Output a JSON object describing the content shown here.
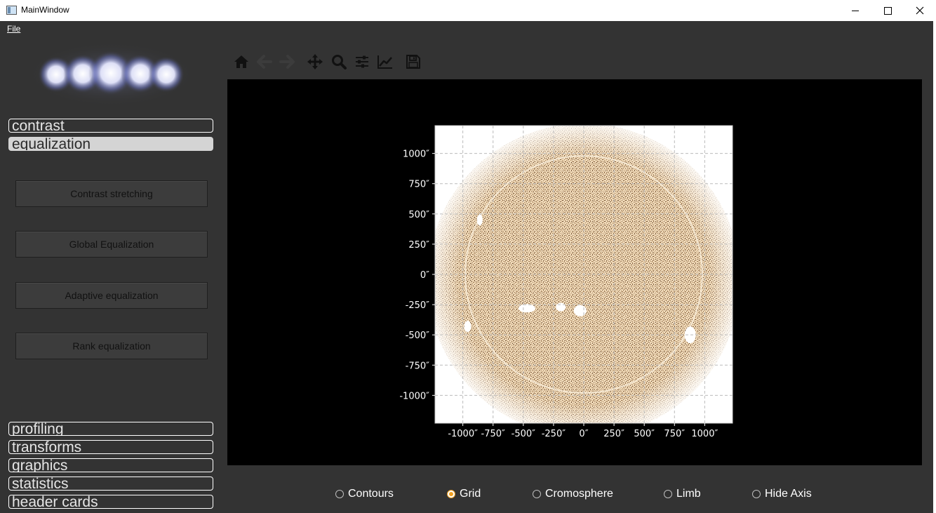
{
  "window": {
    "title": "MainWindow"
  },
  "menu": {
    "file": "File"
  },
  "categories_top": [
    {
      "label": "contrast",
      "active": false
    },
    {
      "label": "equalization",
      "active": true
    }
  ],
  "actions": [
    {
      "label": "Contrast stretching"
    },
    {
      "label": "Global Equalization"
    },
    {
      "label": "Adaptive equalization"
    },
    {
      "label": "Rank equalization"
    }
  ],
  "categories_bottom": [
    {
      "label": "profiling"
    },
    {
      "label": "transforms"
    },
    {
      "label": "graphics"
    },
    {
      "label": "statistics"
    },
    {
      "label": "header cards"
    }
  ],
  "toolbar": {
    "icons": [
      "home-icon",
      "back-arrow-icon",
      "forward-arrow-icon",
      "pan-move-icon",
      "zoom-magnifier-icon",
      "configure-subplots-icon",
      "edit-axis-icon",
      "save-floppy-icon"
    ]
  },
  "chart_data": {
    "type": "heatmap",
    "x_ticks": [
      "-1000″",
      "-750″",
      "-500″",
      "-250″",
      "0″",
      "250″",
      "500″",
      "750″",
      "1000″"
    ],
    "y_ticks": [
      "1000″",
      "750″",
      "500″",
      "250″",
      "0″",
      "-250″",
      "-500″",
      "-750″",
      "-1000″"
    ],
    "x_tick_values": [
      -1000,
      -750,
      -500,
      -250,
      0,
      250,
      500,
      750,
      1000
    ],
    "y_tick_values": [
      1000,
      750,
      500,
      250,
      0,
      -250,
      -500,
      -750,
      -1000
    ],
    "xlim": [
      -1230,
      1230
    ],
    "ylim": [
      -1230,
      1230
    ],
    "grid": true,
    "colormap": "sandy-brown on white",
    "colors": {
      "background": "#000000",
      "image_low": "#f3e2c8",
      "image_high": "#6a4a2a",
      "grid": "#bbbbbb",
      "tick_text": "#ffffff"
    }
  },
  "options": [
    {
      "label": "Contours",
      "checked": false
    },
    {
      "label": "Grid",
      "checked": true
    },
    {
      "label": "Cromosphere",
      "checked": false
    },
    {
      "label": "Limb",
      "checked": false
    },
    {
      "label": "Hide Axis",
      "checked": false
    }
  ],
  "colors": {
    "panel": "#333333",
    "accent_radio": "#f0a020"
  }
}
